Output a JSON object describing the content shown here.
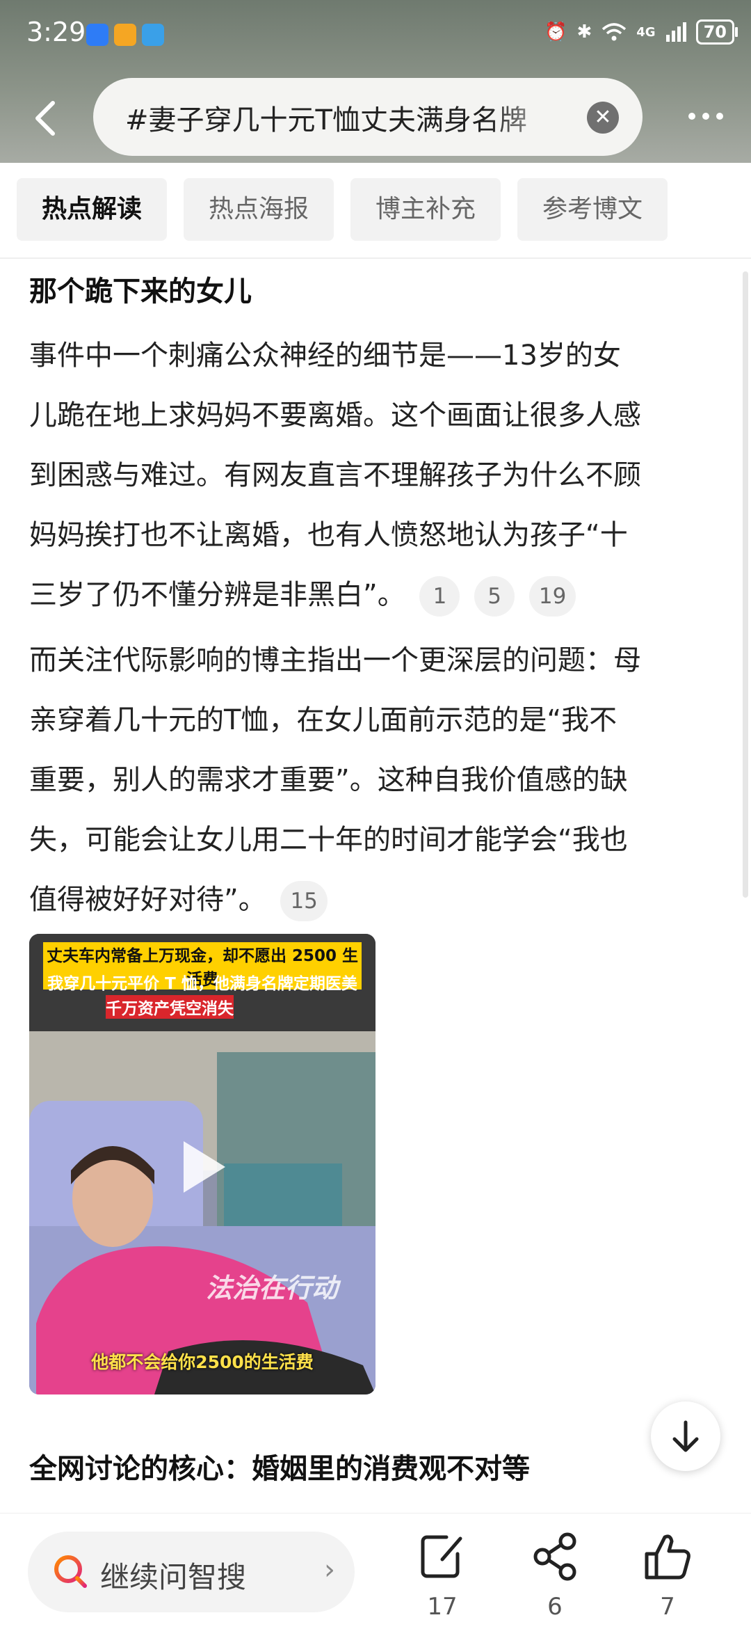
{
  "status_bar": {
    "time": "3:29",
    "network": "4G",
    "battery": "70"
  },
  "header": {
    "search_text": "#妻子穿几十元T恤丈夫满身名牌"
  },
  "tabs": [
    {
      "label": "热点解读",
      "active": true
    },
    {
      "label": "热点海报",
      "active": false
    },
    {
      "label": "博主补充",
      "active": false
    },
    {
      "label": "参考博文",
      "active": false
    }
  ],
  "article": {
    "section1_title": "那个跪下来的女儿",
    "para1_lines": [
      "事件中一个刺痛公众神经的细节是——13岁的女",
      "儿跪在地上求妈妈不要离婚。这个画面让很多人感",
      "到困惑与难过。有网友直言不理解孩子为什么不顾",
      "妈妈挨打也不让离婚，也有人愤怒地认为孩子“十",
      "三岁了仍不懂分辨是非黑白”。"
    ],
    "para1_cites": [
      "1",
      "5",
      "19"
    ],
    "para2_lines": [
      "而关注代际影响的博主指出一个更深层的问题：母",
      "亲穿着几十元的T恤，在女儿面前示范的是“我不",
      "重要，别人的需求才重要”。这种自我价值感的缺",
      "失，可能会让女儿用二十年的时间才能学会“我也",
      "值得被好好对待”。"
    ],
    "para2_cites": [
      "15"
    ],
    "video": {
      "banner_line1": "丈夫车内常备上万现金，却不愿出 2500 生活费",
      "banner_line2": "我穿几十元平价 T 恤，他满身名牌定期医美",
      "banner_line3": "千万资产凭空消失",
      "watermark": "法治在行动",
      "subtitle": "他都不会给你2500的生活费"
    },
    "section2_title": "全网讨论的核心：婚姻里的消费观不对等"
  },
  "bottom_bar": {
    "ask_label": "继续问智搜",
    "comment_count": "17",
    "share_count": "6",
    "like_count": "7"
  }
}
